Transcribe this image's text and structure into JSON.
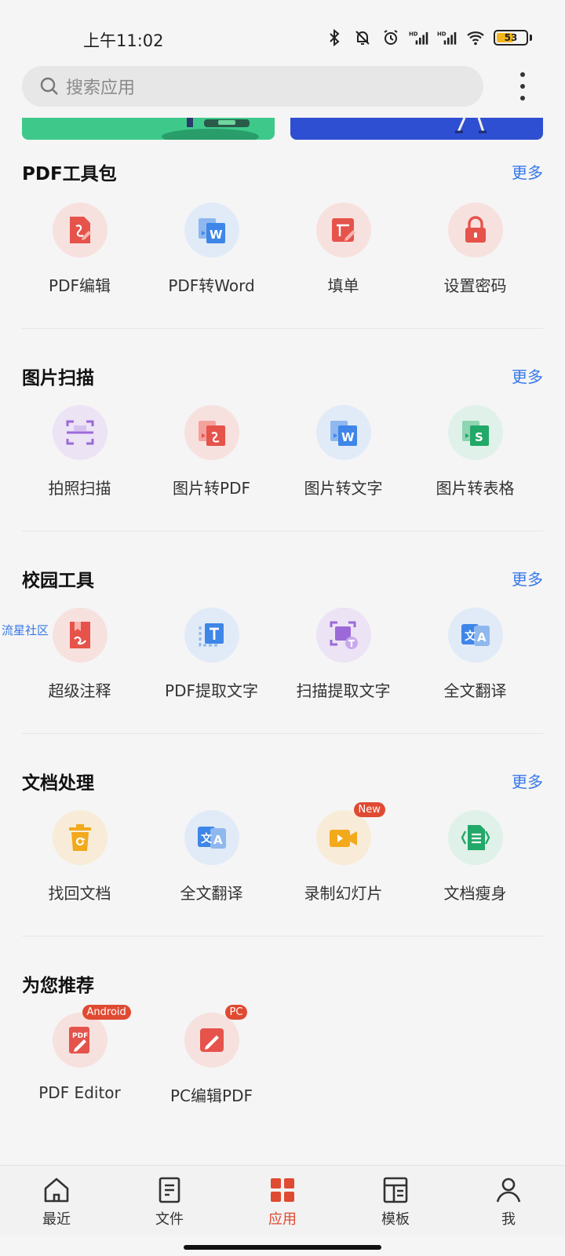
{
  "status": {
    "time": "上午11:02",
    "battery": "53",
    "net_label_1": "HD",
    "net_label_2": "HD"
  },
  "search": {
    "placeholder": "搜索应用"
  },
  "sections": [
    {
      "title": "PDF工具包",
      "more": "更多",
      "items": [
        {
          "label": "PDF编辑",
          "icon": "pdf-edit-icon",
          "color": "red"
        },
        {
          "label": "PDF转Word",
          "icon": "pdf-to-word-icon",
          "color": "blue"
        },
        {
          "label": "填单",
          "icon": "fill-form-icon",
          "color": "red"
        },
        {
          "label": "设置密码",
          "icon": "lock-icon",
          "color": "red"
        }
      ]
    },
    {
      "title": "图片扫描",
      "more": "更多",
      "items": [
        {
          "label": "拍照扫描",
          "icon": "scan-icon",
          "color": "purple"
        },
        {
          "label": "图片转PDF",
          "icon": "image-to-pdf-icon",
          "color": "red"
        },
        {
          "label": "图片转文字",
          "icon": "image-to-text-icon",
          "color": "blue"
        },
        {
          "label": "图片转表格",
          "icon": "image-to-table-icon",
          "color": "green"
        }
      ]
    },
    {
      "title": "校园工具",
      "more": "更多",
      "items": [
        {
          "label": "超级注释",
          "icon": "annotate-icon",
          "color": "red"
        },
        {
          "label": "PDF提取文字",
          "icon": "extract-text-icon",
          "color": "blue"
        },
        {
          "label": "扫描提取文字",
          "icon": "scan-extract-icon",
          "color": "purple"
        },
        {
          "label": "全文翻译",
          "icon": "translate-icon",
          "color": "blue"
        }
      ]
    },
    {
      "title": "文档处理",
      "more": "更多",
      "items": [
        {
          "label": "找回文档",
          "icon": "recover-doc-icon",
          "color": "yellow"
        },
        {
          "label": "全文翻译",
          "icon": "translate-icon",
          "color": "blue"
        },
        {
          "label": "录制幻灯片",
          "icon": "record-slides-icon",
          "color": "yellow",
          "badge": "New"
        },
        {
          "label": "文档瘦身",
          "icon": "doc-slim-icon",
          "color": "green"
        }
      ]
    },
    {
      "title": "为您推荐",
      "items": [
        {
          "label": "PDF Editor",
          "icon": "pdf-editor-app-icon",
          "color": "red",
          "badge": "Android"
        },
        {
          "label": "PC编辑PDF",
          "icon": "pc-edit-pdf-icon",
          "color": "red",
          "badge": "PC"
        }
      ]
    }
  ],
  "watermark": "流星社区",
  "nav": [
    {
      "label": "最近",
      "icon": "home-icon"
    },
    {
      "label": "文件",
      "icon": "file-icon"
    },
    {
      "label": "应用",
      "icon": "apps-icon",
      "active": true
    },
    {
      "label": "模板",
      "icon": "template-icon"
    },
    {
      "label": "我",
      "icon": "profile-icon"
    }
  ],
  "colors": {
    "accent": "#e04a32",
    "link": "#3778e8",
    "red_icon": "#e5534b",
    "blue_icon": "#3e86e8",
    "purple_icon": "#9b6ad8",
    "green_icon": "#22a868",
    "yellow_icon": "#f2a91c"
  }
}
